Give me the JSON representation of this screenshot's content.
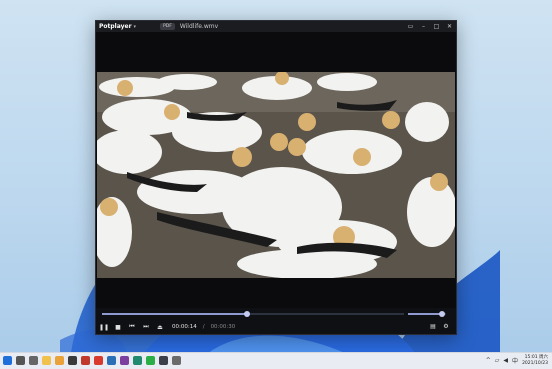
{
  "window": {
    "app_name": "Potplayer",
    "app_caret": "▾",
    "badge": "PDF",
    "file_title": "Wildlife.wmv",
    "buttons": [
      "pin-icon",
      "minimize-icon",
      "maximize-icon",
      "close-icon"
    ]
  },
  "playback": {
    "current_time": "00:00:14",
    "separator": "/",
    "duration": "00:00:30",
    "progress_fraction": 0.48,
    "volume_fraction": 0.9
  },
  "controls": [
    "pause-icon",
    "stop-icon",
    "previous-icon",
    "next-icon",
    "eject-icon"
  ],
  "right_controls": [
    "playlist-icon",
    "settings-icon"
  ],
  "taskbar": {
    "clock_time": "15:01 周六",
    "clock_date": "2021/10/23",
    "icons": [
      "windows-start-icon",
      "search-icon",
      "task-view-icon",
      "file-explorer-icon",
      "chrome-icon",
      "app-icon",
      "app-icon",
      "adobe-icon",
      "app-icon",
      "onenote-icon",
      "app-icon",
      "wechat-icon",
      "app-icon",
      "app-icon"
    ],
    "colors": {
      "windows": "#1e6fd9",
      "chrome": "#e9a33a",
      "adobe": "#d83b2d",
      "onenote": "#7b3fa0",
      "wechat": "#2aae45"
    }
  }
}
